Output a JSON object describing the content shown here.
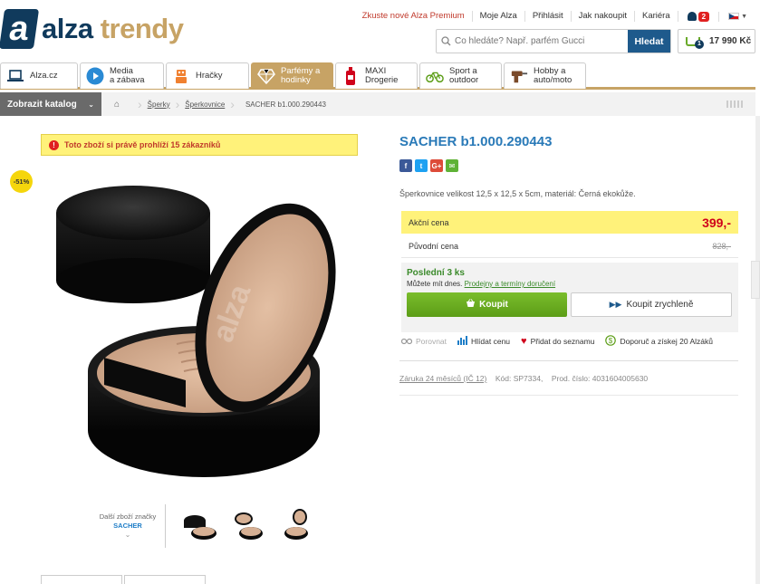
{
  "brand": {
    "logo_letter": "a",
    "name_part1": "alza",
    "name_part2": "trendy"
  },
  "topnav": {
    "premium": "Zkuste nové Alza Premium",
    "moje_alza": "Moje Alza",
    "login": "Přihlásit",
    "how_to_buy": "Jak nakoupit",
    "career": "Kariéra",
    "notifications_count": "2"
  },
  "search": {
    "placeholder": "Co hledáte? Např. parfém Gucci",
    "button": "Hledat"
  },
  "cart": {
    "count": "1",
    "total": "17 990 Kč"
  },
  "categories": [
    {
      "label": "Alza.cz",
      "icon": "laptop-icon"
    },
    {
      "label": "Media\na zábava",
      "icon": "play-icon"
    },
    {
      "label": "Hračky",
      "icon": "robot-icon"
    },
    {
      "label": "Parfémy a\nhodinky",
      "icon": "diamond-icon",
      "active": true
    },
    {
      "label": "MAXI\nDrogerie",
      "icon": "bottle-icon"
    },
    {
      "label": "Sport a\noutdoor",
      "icon": "bike-icon"
    },
    {
      "label": "Hobby a\nauto/moto",
      "icon": "drill-icon"
    }
  ],
  "catalog_button": "Zobrazit katalog",
  "breadcrumb": {
    "items": [
      "Šperky",
      "Šperkovnice"
    ],
    "current": "SACHER b1.000.290443"
  },
  "alert": "Toto zboží si právě prohlíží 15 zákazníků",
  "discount_badge": "-51%",
  "more_from_brand": {
    "label": "Další zboží značky",
    "brand": "SACHER"
  },
  "product": {
    "title": "SACHER b1.000.290443",
    "description": "Šperkovnice velikost 12,5 x 12,5 x 5cm, materiál: Černá ekokůže.",
    "action_price_label": "Akční cena",
    "action_price": "399,-",
    "original_price_label": "Původní cena",
    "original_price": "828,-",
    "stock": "Poslední 3 ks",
    "stock_note": "Můžete mít dnes.",
    "stock_link": "Prodejny a termíny doručení",
    "buy_button": "Koupit",
    "quick_buy_button": "Koupit zrychleně"
  },
  "actions": {
    "compare": "Porovnat",
    "watch_price": "Hlídat cenu",
    "add_to_list": "Přidat do seznamu",
    "recommend": "Doporuč a získej 20 Alzáků"
  },
  "meta": {
    "warranty": "Záruka 24 měsíců (IČ 12)",
    "code": "Kód: SP7334,",
    "prod_number": "Prod. číslo: 4031604005630"
  },
  "social": [
    "f",
    "t",
    "G+",
    "✉"
  ],
  "colors": {
    "navy": "#103a5c",
    "gold": "#c7a365",
    "green": "#5c9d17",
    "red_price": "#d0021b",
    "title_blue": "#2a7ab8"
  }
}
